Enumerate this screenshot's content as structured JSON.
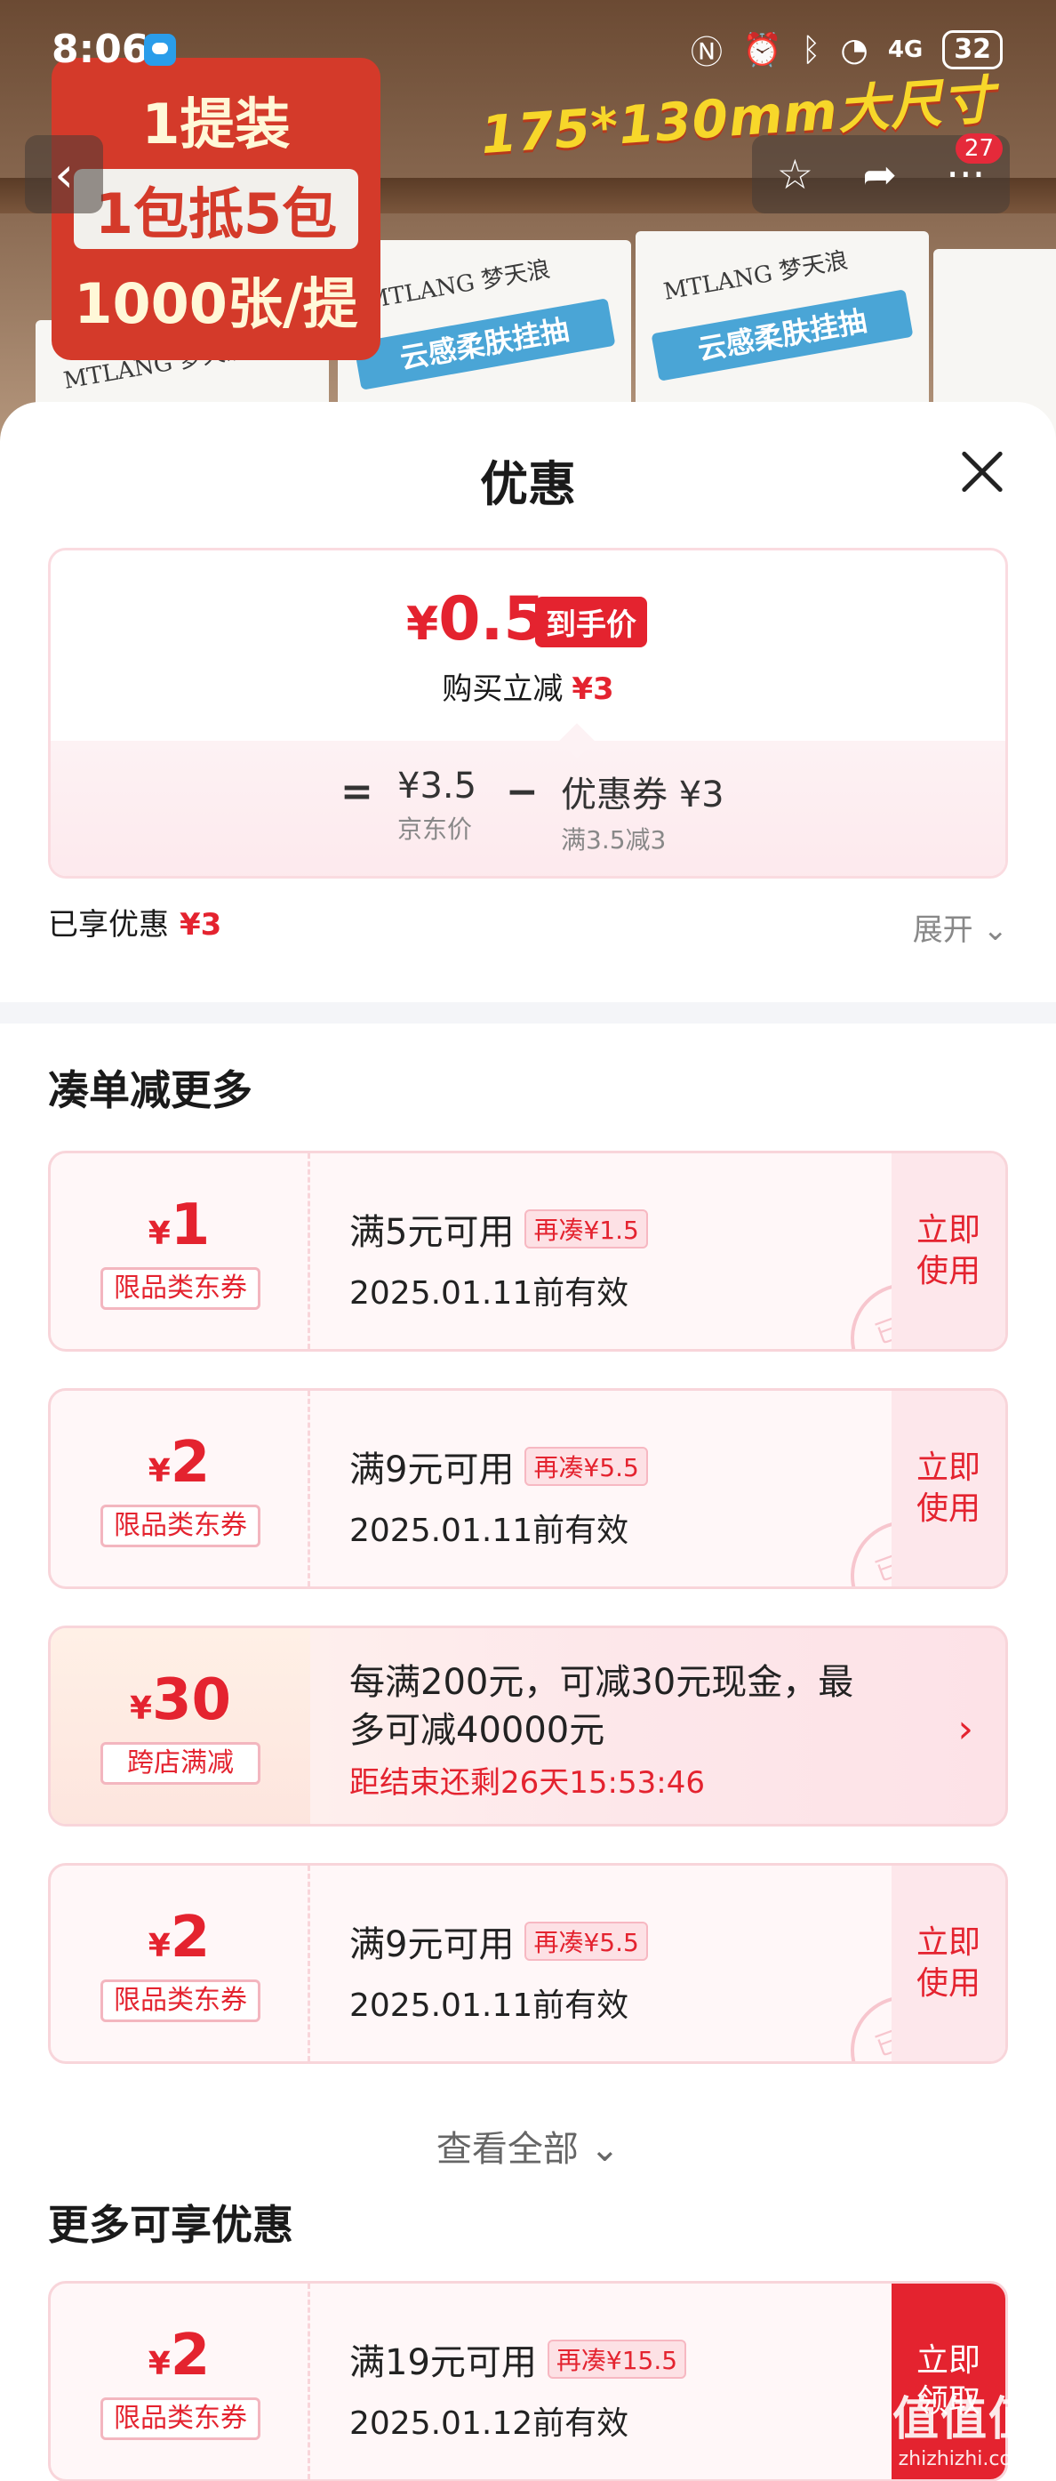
{
  "status_bar": {
    "time": "8:06",
    "icons": [
      "nfc-icon",
      "alarm-icon",
      "bluetooth-icon",
      "wifi-icon",
      "signal-4g-icon"
    ],
    "network": "4G",
    "battery": "32"
  },
  "product_image": {
    "promo_lines": [
      "1提装",
      "1包抵5包",
      "1000张/提"
    ],
    "size_banner": "175*130mm大尺寸",
    "brand": "MTLANG 梦天浪",
    "product_tag": "云感柔肤挂抽"
  },
  "nav": {
    "cart_count": "27"
  },
  "sheet": {
    "title": "优惠",
    "price": {
      "currency": "¥",
      "final_value": "0.5",
      "final_tag": "到手价",
      "reduce_text": "购买立减",
      "reduce_amount": "¥3",
      "equals": "=",
      "jd_price": "¥3.5",
      "jd_price_label": "京东价",
      "minus": "−",
      "coupon_text": "优惠券 ¥3",
      "coupon_rule": "满3.5减3"
    },
    "enjoyed_label": "已享优惠",
    "enjoyed_amount": "¥3",
    "expand_label": "展开",
    "section1_title": "凑单减更多",
    "coupons": [
      {
        "currency": "¥",
        "amount": "1",
        "type": "限品类东券",
        "condition": "满5元可用",
        "need": "再凑¥1.5",
        "validity": "2025.01.11前有效",
        "action": "立即使用",
        "stamp": "已领"
      },
      {
        "currency": "¥",
        "amount": "2",
        "type": "限品类东券",
        "condition": "满9元可用",
        "need": "再凑¥5.5",
        "validity": "2025.01.11前有效",
        "action": "立即使用",
        "stamp": "已领"
      }
    ],
    "special": {
      "currency": "¥",
      "amount": "30",
      "type": "跨店满减",
      "line1": "每满200元，可减30元现金，最",
      "line2": "多可减40000元",
      "countdown": "距结束还剩26天15:53:46"
    },
    "coupon3": {
      "currency": "¥",
      "amount": "2",
      "type": "限品类东券",
      "condition": "满9元可用",
      "need": "再凑¥5.5",
      "validity": "2025.01.11前有效",
      "action": "立即使用",
      "stamp": "已领"
    },
    "view_all": "查看全部",
    "section2_title": "更多可享优惠",
    "coupon4": {
      "currency": "¥",
      "amount": "2",
      "type": "限品类东券",
      "condition": "满19元可用",
      "need": "再凑¥15.5",
      "validity": "2025.01.12前有效",
      "action": "立即领取"
    }
  },
  "watermark": {
    "big": "值值值",
    "small": "zhizhizhi.com"
  }
}
